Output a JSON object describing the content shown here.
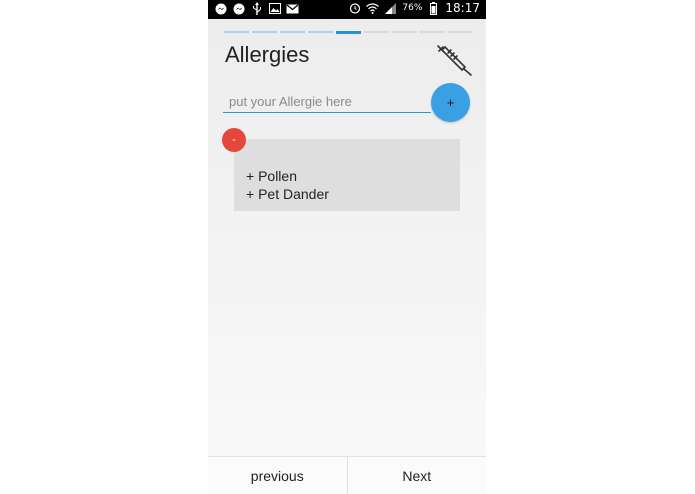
{
  "statusbar": {
    "left_icons": [
      "messenger-icon",
      "messenger-icon",
      "usb-icon",
      "image-icon",
      "gmail-icon"
    ],
    "right_icons": [
      "alarm-icon",
      "wifi-icon",
      "signal-icon",
      "battery-icon"
    ],
    "battery_percent": "76%",
    "time": "18:17"
  },
  "progress": {
    "total_steps": 9,
    "active_step": 5,
    "completed_steps": 4
  },
  "header": {
    "title": "Allergies",
    "icon": "syringe-icon"
  },
  "allergy_input": {
    "placeholder": "put your Allergie here",
    "value": ""
  },
  "add_button": {
    "label": "+"
  },
  "remove_button": {
    "label": "-"
  },
  "allergy_list": {
    "items": [
      "+ Pollen",
      "+ Pet Dander"
    ]
  },
  "navigation": {
    "previous_label": "previous",
    "next_label": "Next"
  },
  "colors": {
    "accent": "#3aa0e4",
    "remove": "#e5473c",
    "list_bg": "#dedede"
  }
}
